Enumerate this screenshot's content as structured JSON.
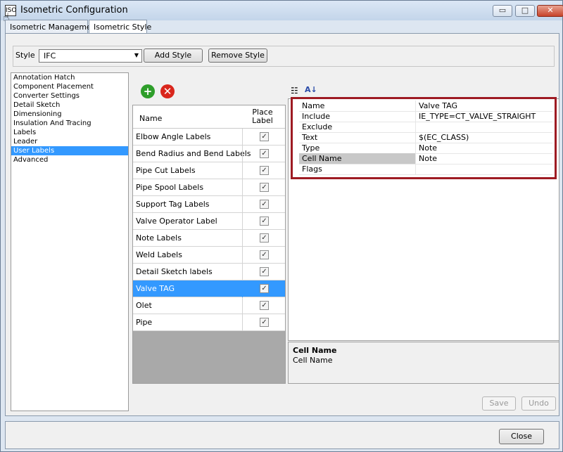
{
  "window": {
    "title": "Isometric Configuration",
    "app_icon": "iso-app-icon",
    "minimize_glyph": "▭",
    "maximize_glyph": "□",
    "close_glyph": "✕"
  },
  "tabs": [
    {
      "label": "Isometric Management",
      "active": false
    },
    {
      "label": "Isometric Style",
      "active": true
    }
  ],
  "style_row": {
    "label": "Style",
    "value": "IFC",
    "add_label": "Add Style",
    "remove_label": "Remove Style"
  },
  "nav": {
    "items": [
      {
        "label": "Annotation Hatch",
        "selected": false
      },
      {
        "label": "Component Placement",
        "selected": false
      },
      {
        "label": "Converter Settings",
        "selected": false
      },
      {
        "label": "Detail Sketch",
        "selected": false
      },
      {
        "label": "Dimensioning",
        "selected": false
      },
      {
        "label": "Insulation And Tracing",
        "selected": false
      },
      {
        "label": "Labels",
        "selected": false
      },
      {
        "label": "Leader",
        "selected": false
      },
      {
        "label": "User Labels",
        "selected": true
      },
      {
        "label": "Advanced",
        "selected": false
      }
    ]
  },
  "labels_grid": {
    "add_icon": "add-green-icon",
    "delete_icon": "delete-red-icon",
    "header_name": "Name",
    "header_place": "Place Label",
    "rows": [
      {
        "name": "Elbow Angle Labels",
        "checked": true,
        "selected": false
      },
      {
        "name": "Bend Radius and Bend Labels",
        "checked": true,
        "selected": false
      },
      {
        "name": "Pipe Cut Labels",
        "checked": true,
        "selected": false
      },
      {
        "name": "Pipe Spool Labels",
        "checked": true,
        "selected": false
      },
      {
        "name": "Support Tag Labels",
        "checked": true,
        "selected": false
      },
      {
        "name": "Valve Operator Label",
        "checked": true,
        "selected": false
      },
      {
        "name": "Note Labels",
        "checked": true,
        "selected": false
      },
      {
        "name": "Weld Labels",
        "checked": true,
        "selected": false
      },
      {
        "name": "Detail Sketch labels",
        "checked": true,
        "selected": false
      },
      {
        "name": "Valve TAG",
        "checked": true,
        "selected": true
      },
      {
        "name": "Olet",
        "checked": true,
        "selected": false
      },
      {
        "name": "Pipe",
        "checked": true,
        "selected": false
      }
    ]
  },
  "properties": {
    "categorized_icon": "categorized-icon",
    "sort_icon": "sort-az-icon",
    "rows": [
      {
        "key": "Name",
        "value": "Valve TAG",
        "highlight": false
      },
      {
        "key": "Include",
        "value": "IE_TYPE=CT_VALVE_STRAIGHT",
        "highlight": false
      },
      {
        "key": "Exclude",
        "value": "",
        "highlight": false
      },
      {
        "key": "Text",
        "value": "$(EC_CLASS)",
        "highlight": false
      },
      {
        "key": "Type",
        "value": "Note",
        "highlight": false
      },
      {
        "key": "Cell Name",
        "value": "Note",
        "highlight": true
      },
      {
        "key": "Flags",
        "value": "",
        "highlight": false
      }
    ],
    "description_title": "Cell Name",
    "description_text": "Cell Name",
    "outline_color": "#9e1b23"
  },
  "actions": {
    "save_label": "Save",
    "undo_label": "Undo",
    "close_label": "Close"
  },
  "colors": {
    "selection": "#3399ff",
    "add_green": "#2e9e2a",
    "delete_red": "#d9261c"
  }
}
